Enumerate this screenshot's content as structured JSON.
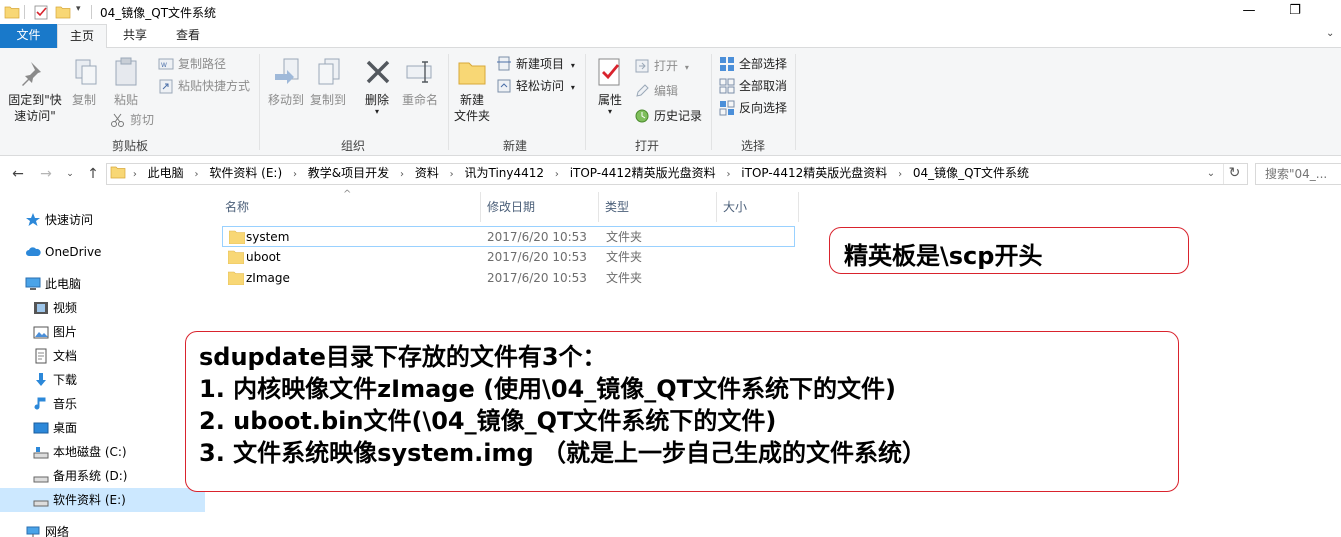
{
  "window": {
    "title": "04_镜像_QT文件系统",
    "min_label": "—",
    "max_label": "❐"
  },
  "tabs": [
    {
      "label": "文件"
    },
    {
      "label": "主页"
    },
    {
      "label": "共享"
    },
    {
      "label": "查看"
    }
  ],
  "ribbon": {
    "clipboard": {
      "group": "剪贴板",
      "pin_label_1": "固定到\"快",
      "pin_label_2": "速访问\"",
      "copy": "复制",
      "paste": "粘贴",
      "copy_path": "复制路径",
      "paste_shortcut": "粘贴快捷方式",
      "cut": "剪切"
    },
    "organize": {
      "group": "组织",
      "move_to": "移动到",
      "copy_to": "复制到",
      "delete": "删除",
      "rename": "重命名"
    },
    "new": {
      "group": "新建",
      "new_folder_1": "新建",
      "new_folder_2": "文件夹",
      "new_item": "新建项目",
      "easy_access": "轻松访问"
    },
    "open": {
      "group": "打开",
      "properties": "属性",
      "open": "打开",
      "edit": "编辑",
      "history": "历史记录"
    },
    "select": {
      "group": "选择",
      "select_all": "全部选择",
      "select_none": "全部取消",
      "invert": "反向选择"
    }
  },
  "address": {
    "crumbs": [
      "此电脑",
      "软件资料 (E:)",
      "教学&项目开发",
      "资料",
      "讯为Tiny4412",
      "iTOP-4412精英版光盘资料",
      "iTOP-4412精英版光盘资料",
      "04_镜像_QT文件系统"
    ],
    "search_placeholder": "搜索\"04_..."
  },
  "nav": {
    "quick_access": "快速访问",
    "onedrive": "OneDrive",
    "this_pc": "此电脑",
    "videos": "视频",
    "pictures": "图片",
    "documents": "文档",
    "downloads": "下载",
    "music": "音乐",
    "desktop": "桌面",
    "drive_c": "本地磁盘 (C:)",
    "drive_d": "备用系统 (D:)",
    "drive_e": "软件资料 (E:)",
    "network": "网络"
  },
  "columns": {
    "name": "名称",
    "date": "修改日期",
    "type": "类型",
    "size": "大小"
  },
  "files": [
    {
      "name": "system",
      "date": "2017/6/20 10:53",
      "type": "文件夹"
    },
    {
      "name": "uboot",
      "date": "2017/6/20 10:53",
      "type": "文件夹"
    },
    {
      "name": "zImage",
      "date": "2017/6/20 10:53",
      "type": "文件夹"
    }
  ],
  "annotations": {
    "note1": "精英板是\\scp开头",
    "note2": [
      "sdupdate目录下存放的文件有3个：",
      "1. 内核映像文件zImage (使用\\04_镜像_QT文件系统下的文件)",
      "2. uboot.bin文件(\\04_镜像_QT文件系统下的文件)",
      "3. 文件系统映像system.img （就是上一步自己生成的文件系统）"
    ]
  },
  "colors": {
    "accent": "#1979ca",
    "folder": "#f8d775",
    "selection": "#cce8ff",
    "callout_border": "#d9232d"
  }
}
